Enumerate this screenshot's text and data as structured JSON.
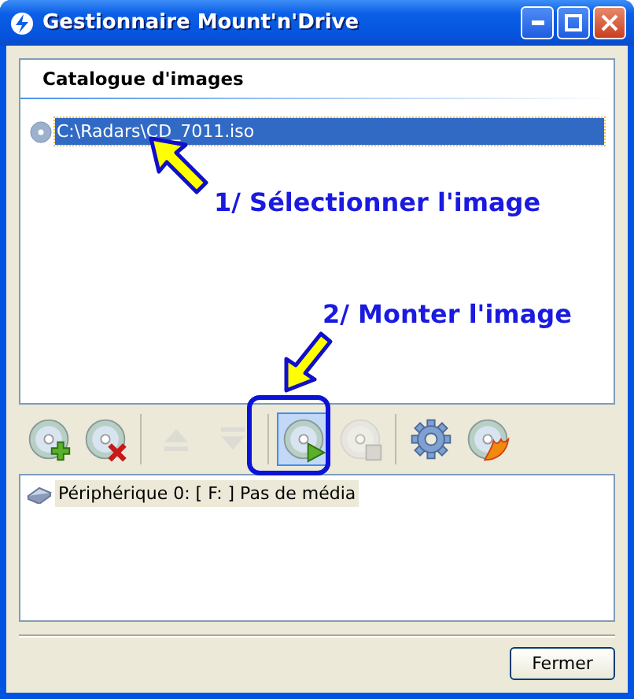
{
  "window": {
    "title": "Gestionnaire Mount'n'Drive"
  },
  "catalog": {
    "header": "Catalogue d'images",
    "items": [
      {
        "path": "C:\\Radars\\CD_7011.iso",
        "selected": true
      }
    ]
  },
  "toolbar": [
    {
      "kind": "add",
      "disabled": false,
      "highlighted": false
    },
    {
      "kind": "remove",
      "disabled": false,
      "highlighted": false
    },
    {
      "kind": "separator"
    },
    {
      "kind": "up",
      "disabled": true,
      "highlighted": false
    },
    {
      "kind": "down",
      "disabled": true,
      "highlighted": false
    },
    {
      "kind": "separator"
    },
    {
      "kind": "mount",
      "disabled": false,
      "highlighted": true
    },
    {
      "kind": "unmount",
      "disabled": true,
      "highlighted": false
    },
    {
      "kind": "separator"
    },
    {
      "kind": "settings",
      "disabled": false,
      "highlighted": false
    },
    {
      "kind": "burn",
      "disabled": false,
      "highlighted": false
    }
  ],
  "devices": [
    {
      "label": "Périphérique 0: [ F: ] Pas de média",
      "selected": true
    }
  ],
  "annotations": [
    {
      "text": "1/ Sélectionner l'image"
    },
    {
      "text": "2/ Monter l'image"
    }
  ],
  "close_button": "Fermer"
}
